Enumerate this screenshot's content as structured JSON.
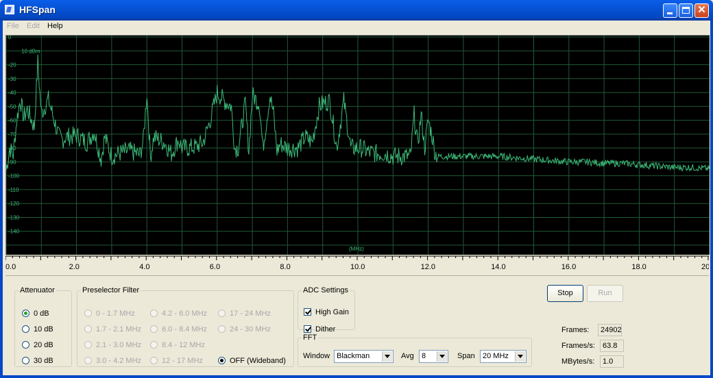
{
  "window": {
    "title": "HFSpan",
    "buttons": [
      "minimize",
      "maximize",
      "close"
    ]
  },
  "menu": [
    {
      "label": "File",
      "enabled": false
    },
    {
      "label": "Edit",
      "enabled": false
    },
    {
      "label": "Help",
      "enabled": true
    }
  ],
  "spectrum": {
    "y_unit_label": "10 dBm",
    "y_ticks": [
      "0",
      "-20",
      "-30",
      "-40",
      "-50",
      "-60",
      "-70",
      "-80",
      "-90",
      "-100",
      "-110",
      "-120",
      "-130",
      "-140"
    ],
    "x_unit_label": "(MHz)",
    "x_ticks": [
      "0.0",
      "2.0",
      "4.0",
      "6.0",
      "8.0",
      "10.0",
      "12.0",
      "14.0",
      "16.0",
      "18.0",
      "20"
    ],
    "trace_color": "#3dbb7a",
    "grid_color": "#1f5a36"
  },
  "chart_data": {
    "type": "line",
    "xlabel": "(MHz)",
    "ylabel": "10 dBm",
    "xlim": [
      0,
      20
    ],
    "ylim": [
      -150,
      0
    ],
    "series": [
      {
        "x": [
          0.0,
          0.1,
          0.2,
          0.3,
          0.4,
          0.5,
          0.6,
          0.8,
          0.9,
          1.0,
          1.2,
          1.5,
          1.6,
          1.7,
          2.0,
          2.3,
          2.5,
          2.7,
          2.8,
          3.0,
          3.2,
          3.5,
          3.8,
          3.9,
          4.0,
          4.1,
          4.2,
          4.5,
          4.7,
          4.9,
          5.0,
          5.2,
          5.4,
          5.6,
          5.8,
          6.0,
          6.2,
          6.4,
          6.5,
          6.6,
          6.8,
          6.9,
          7.0,
          7.2,
          7.3,
          7.5,
          7.6,
          7.7,
          7.8,
          8.0,
          8.3,
          8.5,
          8.7,
          8.9,
          9.0,
          9.2,
          9.4,
          9.6,
          9.8,
          10.0,
          10.1,
          10.3,
          10.5,
          10.8,
          11.0,
          11.2,
          11.4,
          11.5,
          11.6,
          11.7,
          11.8,
          11.9,
          12.0,
          12.1,
          12.2,
          12.3,
          12.5,
          13.0,
          13.5,
          14.0,
          14.5,
          15.0,
          15.5,
          16.0,
          16.5,
          17.0,
          17.5,
          18.0,
          18.5,
          19.0,
          19.5,
          20.0
        ],
        "y": [
          -96,
          -80,
          -85,
          -60,
          -45,
          -58,
          -52,
          -65,
          -18,
          -55,
          -45,
          -72,
          -74,
          -72,
          -71,
          -76,
          -68,
          -88,
          -72,
          -86,
          -84,
          -82,
          -85,
          -75,
          -40,
          -86,
          -72,
          -76,
          -84,
          -74,
          -80,
          -80,
          -79,
          -76,
          -60,
          -40,
          -46,
          -50,
          -80,
          -80,
          -48,
          -82,
          -42,
          -48,
          -80,
          -42,
          -55,
          -82,
          -77,
          -80,
          -80,
          -72,
          -76,
          -50,
          -48,
          -46,
          -80,
          -46,
          -80,
          -80,
          -80,
          -83,
          -84,
          -84,
          -86,
          -86,
          -86,
          -86,
          -56,
          -78,
          -56,
          -80,
          -60,
          -70,
          -84,
          -86,
          -86,
          -86,
          -86,
          -86,
          -87,
          -88,
          -89,
          -90,
          -90,
          -91,
          -91,
          -92,
          -93,
          -94,
          -94,
          -95
        ]
      }
    ]
  },
  "attenuator": {
    "legend": "Attenuator",
    "options": [
      "0 dB",
      "10 dB",
      "20 dB",
      "30 dB"
    ],
    "selected": "0 dB"
  },
  "preselector": {
    "legend": "Preselector Filter",
    "col1": [
      "0 - 1.7 MHz",
      "1.7 - 2.1 MHz",
      "2.1 - 3.0 MHz",
      "3.0 - 4.2 MHz"
    ],
    "col2": [
      "4.2 - 6.0 MHz",
      "6.0 - 8.4 MHz",
      "8.4 - 12 MHz",
      "12 - 17 MHz"
    ],
    "col3": [
      "17 - 24 MHz",
      "24 - 30 MHz"
    ],
    "selected": "OFF (Wideband)"
  },
  "adc": {
    "legend": "ADC Settings",
    "high_gain": "High Gain",
    "dither": "Dither",
    "high_gain_checked": true,
    "dither_checked": true
  },
  "fft": {
    "legend": "FFT",
    "window_label": "Window",
    "window_value": "Blackman",
    "avg_label": "Avg",
    "avg_value": "8",
    "span_label": "Span",
    "span_value": "20 MHz"
  },
  "controls": {
    "stop": "Stop",
    "run": "Run"
  },
  "stats": {
    "frames_label": "Frames:",
    "frames_value": "24902",
    "fps_label": "Frames/s:",
    "fps_value": "63.8",
    "mbps_label": "MBytes/s:",
    "mbps_value": "1.0"
  }
}
